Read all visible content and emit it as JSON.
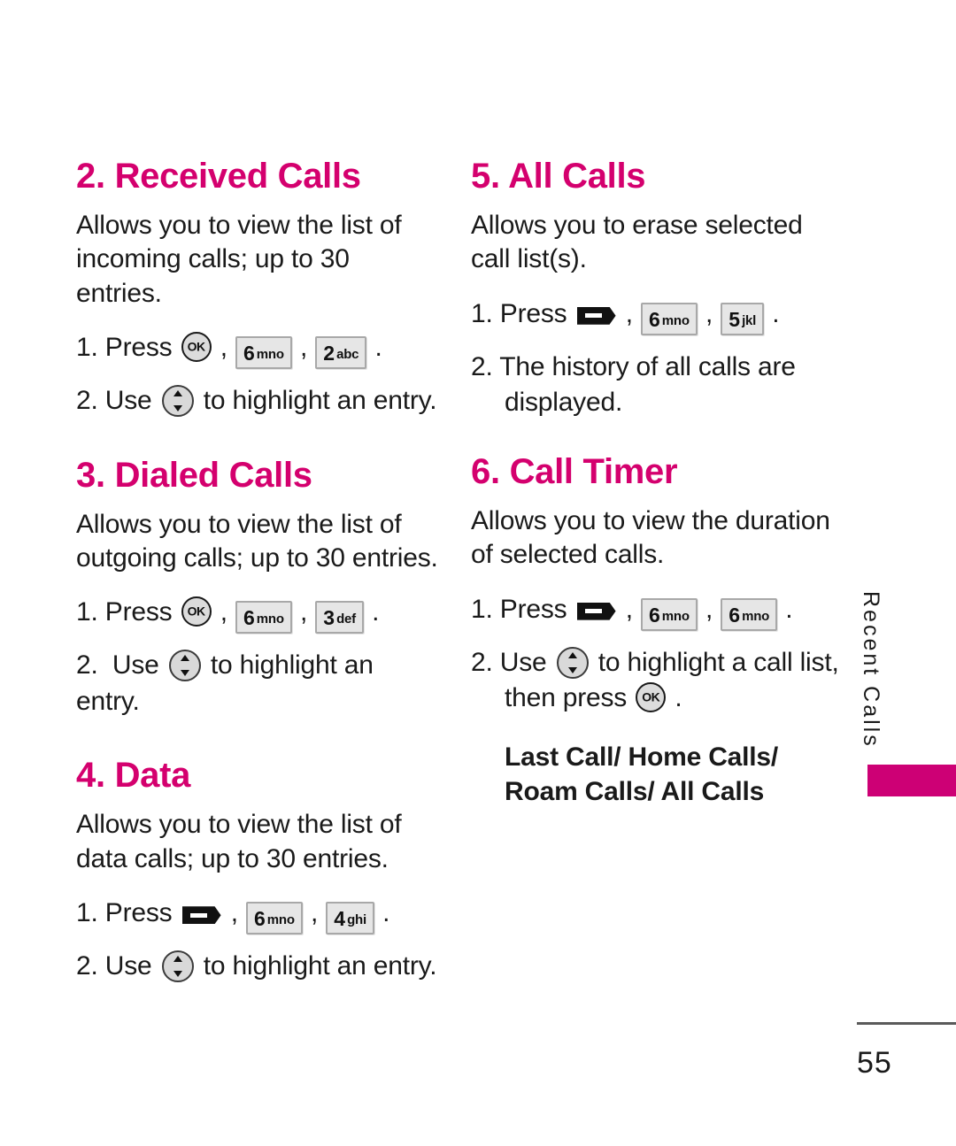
{
  "page": {
    "number": "55",
    "side_tab_label": "Recent Calls",
    "accent_color": "#d4006e",
    "tab_color": "#cd0075"
  },
  "left_column": [
    {
      "heading": "2. Received Calls",
      "description": "Allows you to view the list of incoming calls; up to 30 entries.",
      "step1_prefix": "1. Press ",
      "step1_keys": [
        {
          "type": "ok"
        },
        {
          "type": "keycap",
          "digit": "6",
          "letters": "mno"
        },
        {
          "type": "keycap",
          "digit": "2",
          "letters": "abc"
        }
      ],
      "step2_prefix": "2. Use ",
      "step2_suffix": " to highlight an entry."
    },
    {
      "heading": "3. Dialed Calls",
      "description": "Allows you to view the list of outgoing calls; up to 30 entries.",
      "step1_prefix": "1. Press ",
      "step1_keys": [
        {
          "type": "ok"
        },
        {
          "type": "keycap",
          "digit": "6",
          "letters": "mno"
        },
        {
          "type": "keycap",
          "digit": "3",
          "letters": "def"
        }
      ],
      "step2_prefix": "2.  Use ",
      "step2_suffix": " to highlight an entry."
    },
    {
      "heading": "4. Data",
      "description": "Allows you to view the list of data calls; up to 30 entries.",
      "step1_prefix": "1. Press ",
      "step1_keys": [
        {
          "type": "softkey"
        },
        {
          "type": "keycap",
          "digit": "6",
          "letters": "mno"
        },
        {
          "type": "keycap",
          "digit": "4",
          "letters": "ghi"
        }
      ],
      "step2_prefix": "2. Use ",
      "step2_suffix": " to highlight an entry."
    }
  ],
  "right_column": [
    {
      "heading": "5. All Calls",
      "description": "Allows you to erase selected call list(s).",
      "step1_prefix": "1. Press ",
      "step1_keys": [
        {
          "type": "softkey"
        },
        {
          "type": "keycap",
          "digit": "6",
          "letters": "mno"
        },
        {
          "type": "keycap",
          "digit": "5",
          "letters": "jkl"
        }
      ],
      "step2_text": "2. The history of all calls are",
      "step2_cont": "displayed."
    },
    {
      "heading": "6. Call Timer",
      "description": "Allows you to view the duration of selected calls.",
      "step1_prefix": "1. Press ",
      "step1_keys": [
        {
          "type": "softkey"
        },
        {
          "type": "keycap",
          "digit": "6",
          "letters": "mno"
        },
        {
          "type": "keycap",
          "digit": "6",
          "letters": "mno"
        }
      ],
      "step2_prefix": "2. Use ",
      "step2_suffix": " to highlight a call list,",
      "step2_cont_prefix": "then press ",
      "step2_cont_suffix": " .",
      "bold_list": "Last Call/ Home Calls/ Roam Calls/ All Calls"
    }
  ]
}
